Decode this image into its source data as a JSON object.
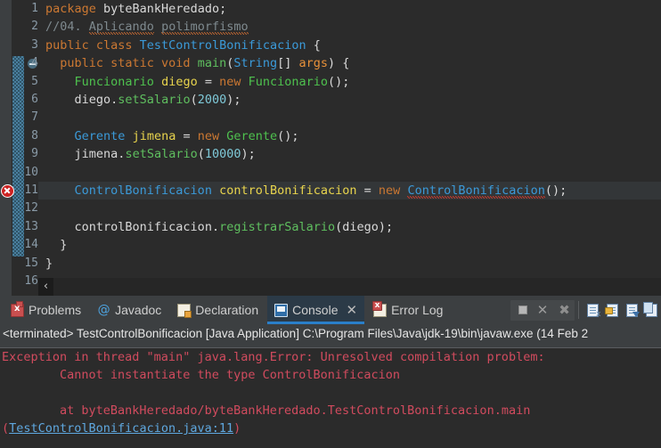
{
  "editor": {
    "lines": [
      {
        "n": "1",
        "tokens": [
          {
            "t": "package ",
            "c": "kw"
          },
          {
            "t": "byteBankHeredado",
            "c": "pl"
          },
          {
            "t": ";",
            "c": "pl"
          }
        ]
      },
      {
        "n": "2",
        "tokens": [
          {
            "t": "//04. ",
            "c": "cmt"
          },
          {
            "t": "Aplicando",
            "c": "cmt squig-o"
          },
          {
            "t": " ",
            "c": "cmt"
          },
          {
            "t": "polimorfismo",
            "c": "cmt squig-o"
          }
        ]
      },
      {
        "n": "3",
        "tokens": [
          {
            "t": "public class ",
            "c": "kw"
          },
          {
            "t": "TestControlBonificacion",
            "c": "typ"
          },
          {
            "t": " {",
            "c": "pl"
          }
        ]
      },
      {
        "n": "4",
        "tokens": [
          {
            "t": "  public static void ",
            "c": "kw"
          },
          {
            "t": "main",
            "c": "mth"
          },
          {
            "t": "(",
            "c": "pl"
          },
          {
            "t": "String",
            "c": "typ"
          },
          {
            "t": "[] ",
            "c": "pl"
          },
          {
            "t": "args",
            "c": "kw2"
          },
          {
            "t": ") {",
            "c": "pl"
          }
        ],
        "fold": true
      },
      {
        "n": "5",
        "tokens": [
          {
            "t": "    ",
            "c": "pl"
          },
          {
            "t": "Funcionario",
            "c": "typg"
          },
          {
            "t": " ",
            "c": "pl"
          },
          {
            "t": "diego",
            "c": "fld"
          },
          {
            "t": " = ",
            "c": "pl"
          },
          {
            "t": "new ",
            "c": "kw"
          },
          {
            "t": "Funcionario",
            "c": "typg"
          },
          {
            "t": "();",
            "c": "pl"
          }
        ]
      },
      {
        "n": "6",
        "tokens": [
          {
            "t": "    ",
            "c": "pl"
          },
          {
            "t": "diego",
            "c": "pl"
          },
          {
            "t": ".",
            "c": "pl"
          },
          {
            "t": "setSalario",
            "c": "mth"
          },
          {
            "t": "(",
            "c": "pl"
          },
          {
            "t": "2000",
            "c": "num"
          },
          {
            "t": ");",
            "c": "pl"
          }
        ]
      },
      {
        "n": "7",
        "tokens": []
      },
      {
        "n": "8",
        "tokens": [
          {
            "t": "    ",
            "c": "pl"
          },
          {
            "t": "Gerente",
            "c": "typ"
          },
          {
            "t": " ",
            "c": "pl"
          },
          {
            "t": "jimena",
            "c": "fld"
          },
          {
            "t": " = ",
            "c": "pl"
          },
          {
            "t": "new ",
            "c": "kw"
          },
          {
            "t": "Gerente",
            "c": "typg"
          },
          {
            "t": "();",
            "c": "pl"
          }
        ]
      },
      {
        "n": "9",
        "tokens": [
          {
            "t": "    ",
            "c": "pl"
          },
          {
            "t": "jimena",
            "c": "pl"
          },
          {
            "t": ".",
            "c": "pl"
          },
          {
            "t": "setSalario",
            "c": "mth"
          },
          {
            "t": "(",
            "c": "pl"
          },
          {
            "t": "10000",
            "c": "num"
          },
          {
            "t": ");",
            "c": "pl"
          }
        ]
      },
      {
        "n": "10",
        "tokens": []
      },
      {
        "n": "11",
        "tokens": [
          {
            "t": "    ",
            "c": "pl"
          },
          {
            "t": "ControlBonificacion",
            "c": "typ"
          },
          {
            "t": " ",
            "c": "pl"
          },
          {
            "t": "controlBonificacion",
            "c": "fld"
          },
          {
            "t": " = ",
            "c": "pl"
          },
          {
            "t": "new ",
            "c": "kw"
          },
          {
            "t": "ControlBonificacion",
            "c": "typ squig"
          },
          {
            "t": "();",
            "c": "pl"
          }
        ],
        "current": true,
        "error": true
      },
      {
        "n": "12",
        "tokens": []
      },
      {
        "n": "13",
        "tokens": [
          {
            "t": "    ",
            "c": "pl"
          },
          {
            "t": "controlBonificacion",
            "c": "pl"
          },
          {
            "t": ".",
            "c": "pl"
          },
          {
            "t": "registrarSalario",
            "c": "mth"
          },
          {
            "t": "(",
            "c": "pl"
          },
          {
            "t": "diego",
            "c": "pl"
          },
          {
            "t": ");",
            "c": "pl"
          }
        ]
      },
      {
        "n": "14",
        "tokens": [
          {
            "t": "  }",
            "c": "pl"
          }
        ]
      },
      {
        "n": "15",
        "tokens": [
          {
            "t": "}",
            "c": "pl"
          }
        ]
      },
      {
        "n": "16",
        "tokens": []
      }
    ],
    "scroll_left_arrow": "‹"
  },
  "panel": {
    "tabs": [
      {
        "label": "Problems",
        "icon": "problems-icon",
        "active": false,
        "closable": false
      },
      {
        "label": "Javadoc",
        "icon": "javadoc-icon",
        "active": false,
        "closable": false
      },
      {
        "label": "Declaration",
        "icon": "declaration-icon",
        "active": false,
        "closable": false
      },
      {
        "label": "Console",
        "icon": "console-icon",
        "active": true,
        "closable": true,
        "close_glyph": "✕"
      },
      {
        "label": "Error Log",
        "icon": "error-log-icon",
        "active": false,
        "closable": false
      }
    ],
    "toolbar": {
      "stop_label": "stop-icon",
      "remove_glyph": "✕",
      "remove_all_glyph": "✖",
      "icons": [
        "open-console-icon",
        "pin-console-icon",
        "display-selected-console-icon",
        "new-console-view-icon"
      ]
    },
    "terminated_line": "<terminated> TestControlBonificacion [Java Application] C:\\Program Files\\Java\\jdk-19\\bin\\javaw.exe  (14 Feb 2",
    "console_output": [
      {
        "segments": [
          {
            "t": "Exception in thread \"main\" java.lang.Error: Unresolved compilation problem: ",
            "link": false
          }
        ]
      },
      {
        "segments": [
          {
            "t": "\tCannot instantiate the type ControlBonificacion",
            "link": false
          }
        ]
      },
      {
        "segments": [
          {
            "t": "",
            "link": false
          }
        ]
      },
      {
        "segments": [
          {
            "t": "\tat byteBankHeredado/byteBankHeredado.TestControlBonificacion.main",
            "link": false
          }
        ]
      },
      {
        "segments": [
          {
            "t": "(",
            "link": false
          },
          {
            "t": "TestControlBonificacion.java:11",
            "link": true
          },
          {
            "t": ")",
            "link": false
          }
        ]
      }
    ]
  },
  "colors": {
    "editor_bg": "#2b2b2b",
    "panel_bg": "#3c3f41",
    "accent_blue": "#2a7fc9",
    "error_red": "#d14b5e",
    "link_blue": "#5fa8e0"
  }
}
